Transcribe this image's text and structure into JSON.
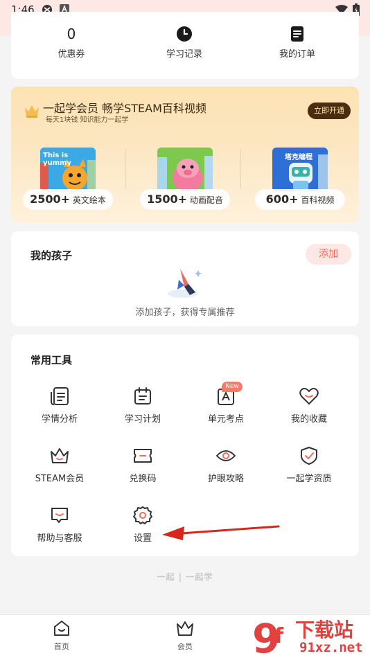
{
  "status_bar": {
    "time": "1:46"
  },
  "stats": [
    {
      "value": "0",
      "label": "优惠券"
    },
    {
      "icon": "clock-icon",
      "label": "学习记录"
    },
    {
      "icon": "order-list-icon",
      "label": "我的订单"
    }
  ],
  "vip_banner": {
    "title": "一起学会员 畅学STEAM百科视频",
    "subtitle": "每天1块钱 知识能力一起学",
    "button": "立即开通",
    "features": [
      {
        "count": "2500+",
        "label": "英文绘本",
        "thumb_text": "This is yummy"
      },
      {
        "count": "1500+",
        "label": "动画配音"
      },
      {
        "count": "600+",
        "label": "百科视频",
        "thumb_text": "塔克编程"
      }
    ]
  },
  "kids": {
    "title": "我的孩子",
    "add_button": "添加",
    "hint": "添加孩子，获得专属推荐"
  },
  "tools": {
    "title": "常用工具",
    "new_badge": "New",
    "items": [
      {
        "label": "学情分析",
        "icon": "study-analysis-icon"
      },
      {
        "label": "学习计划",
        "icon": "calendar-plan-icon"
      },
      {
        "label": "单元考点",
        "icon": "unit-points-icon"
      },
      {
        "label": "我的收藏",
        "icon": "heart-icon"
      },
      {
        "label": "STEAM会员",
        "icon": "crown-icon"
      },
      {
        "label": "兑换码",
        "icon": "ticket-icon"
      },
      {
        "label": "护眼攻略",
        "icon": "eye-icon"
      },
      {
        "label": "一起学资质",
        "icon": "shield-check-icon"
      },
      {
        "label": "帮助与客服",
        "icon": "help-chat-icon"
      },
      {
        "label": "设置",
        "icon": "gear-icon"
      }
    ]
  },
  "footer_logo": "一起 | 一起学",
  "bottom_nav": [
    {
      "label": "首页",
      "icon": "home-icon"
    },
    {
      "label": "会员",
      "icon": "member-crown-icon"
    }
  ],
  "watermark": {
    "brand": "下载站",
    "url": "91xz.net"
  },
  "colors": {
    "accent": "#f26a5b",
    "vip_dark": "#4a2c10",
    "arrow": "#d9261c"
  }
}
